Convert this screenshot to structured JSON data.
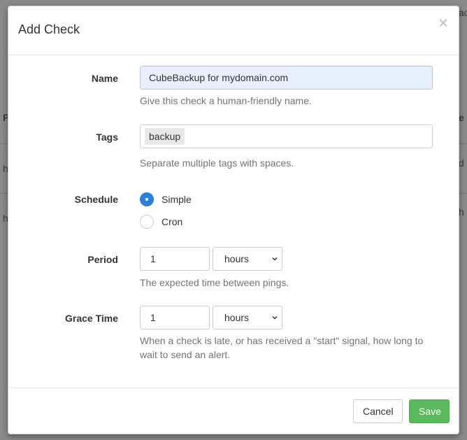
{
  "modal": {
    "title": "Add Check",
    "close_glyph": "×"
  },
  "form": {
    "name": {
      "label": "Name",
      "value": "CubeBackup for mydomain.com",
      "help": "Give this check a human-friendly name."
    },
    "tags": {
      "label": "Tags",
      "items": [
        "backup"
      ],
      "help": "Separate multiple tags with spaces."
    },
    "schedule": {
      "label": "Schedule",
      "options": [
        {
          "label": "Simple",
          "checked": true
        },
        {
          "label": "Cron",
          "checked": false
        }
      ]
    },
    "period": {
      "label": "Period",
      "value": "1",
      "unit": "hours",
      "help": "The expected time between pings."
    },
    "grace": {
      "label": "Grace Time",
      "value": "1",
      "unit": "hours",
      "help": "When a check is late, or has received a \"start\" signal, how long to wait to send an alert."
    }
  },
  "footer": {
    "cancel_label": "Cancel",
    "save_label": "Save"
  },
  "colors": {
    "accent": "#2b7fd8",
    "save": "#5cb85c"
  }
}
